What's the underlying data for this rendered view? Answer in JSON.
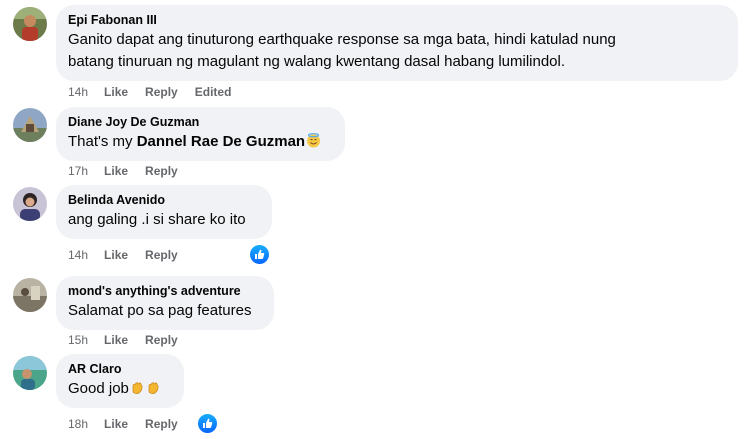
{
  "comments": [
    {
      "author": "Epi Fabonan III",
      "text_line1": "Ganito dapat ang tinuturong earthquake response sa mga bata, hindi katulad nung",
      "text_line2": "batang tinuruan ng magulant ng walang kwentang dasal habang lumilindol.",
      "time": "14h",
      "like": "Like",
      "reply": "Reply",
      "edited": "Edited"
    },
    {
      "author": "Diane Joy De Guzman",
      "text": "That's my",
      "mention": "Dannel Rae De Guzman",
      "emoji": "smiling-face-with-halo",
      "time": "17h",
      "like": "Like",
      "reply": "Reply"
    },
    {
      "author": "Belinda Avenido",
      "text": "ang galing .i si share ko ito",
      "time": "14h",
      "like": "Like",
      "reply": "Reply",
      "reaction": "like-reaction"
    },
    {
      "author": "mond's anything's adventure",
      "text": "Salamat po sa pag features",
      "time": "15h",
      "like": "Like",
      "reply": "Reply"
    },
    {
      "author": "AR Claro",
      "text": "Good job",
      "emoji": "clapping-hands",
      "time": "18h",
      "like": "Like",
      "reply": "Reply",
      "reaction": "like-reaction"
    }
  ],
  "colors": {
    "bubble": "#f0f2f5",
    "meta_text": "#65676b",
    "like_blue": "#0866ff"
  }
}
